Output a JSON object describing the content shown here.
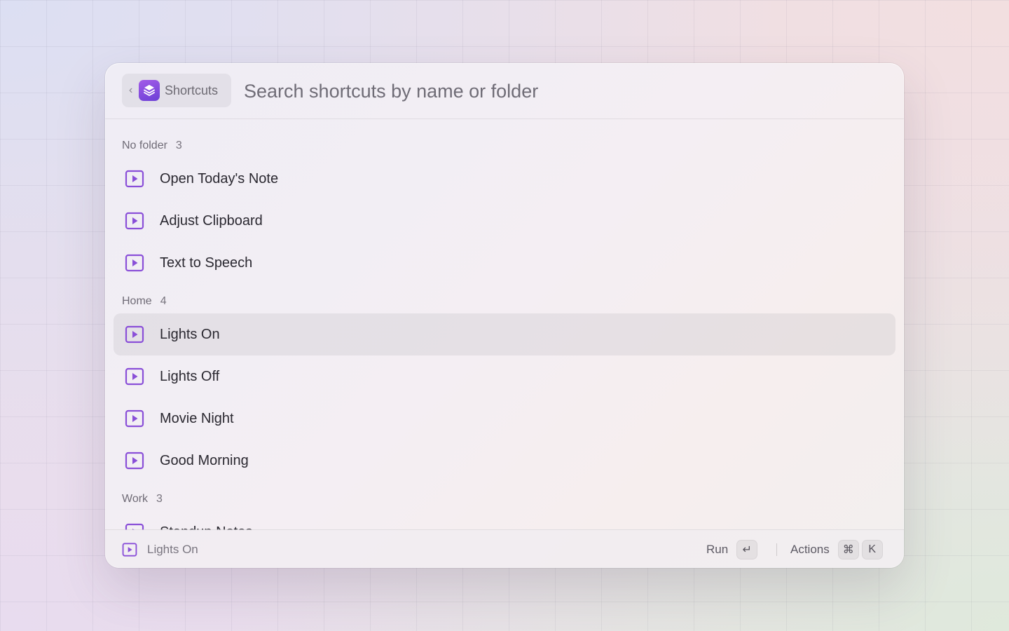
{
  "header": {
    "back_label": "Shortcuts",
    "chevron": "‹",
    "search_placeholder": "Search shortcuts by name or folder",
    "search_value": ""
  },
  "sections": [
    {
      "title": "No folder",
      "count": "3",
      "items": [
        "Open Today's Note",
        "Adjust Clipboard",
        "Text to Speech"
      ]
    },
    {
      "title": "Home",
      "count": "4",
      "items": [
        "Lights On",
        "Lights Off",
        "Movie Night",
        "Good Morning"
      ]
    },
    {
      "title": "Work",
      "count": "3",
      "items": [
        "Standup Notes"
      ]
    }
  ],
  "selected_item": "Lights On",
  "footer": {
    "selected_label": "Lights On",
    "run_label": "Run",
    "run_key": "↵",
    "actions_label": "Actions",
    "actions_keys": [
      "⌘",
      "K"
    ]
  },
  "colors": {
    "accent": "#8a4fd8",
    "icon_gradient_start": "#a35ce8",
    "icon_gradient_end": "#6b3fd6"
  },
  "icons": {
    "shortcut": "play-square-icon",
    "app": "shortcuts-layers-icon"
  }
}
